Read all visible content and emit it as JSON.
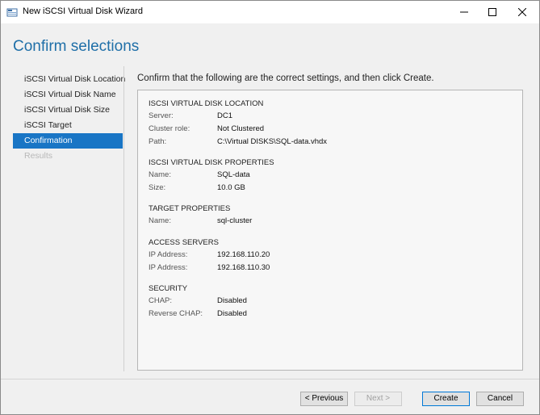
{
  "window": {
    "title": "New iSCSI Virtual Disk Wizard",
    "icon": "wizard-app-icon"
  },
  "page": {
    "heading": "Confirm selections",
    "instruction": "Confirm that the following are the correct settings, and then click Create."
  },
  "nav": {
    "items": [
      {
        "label": "iSCSI Virtual Disk Location",
        "state": "normal"
      },
      {
        "label": "iSCSI Virtual Disk Name",
        "state": "normal"
      },
      {
        "label": "iSCSI Virtual Disk Size",
        "state": "normal"
      },
      {
        "label": "iSCSI Target",
        "state": "normal"
      },
      {
        "label": "Confirmation",
        "state": "active"
      },
      {
        "label": "Results",
        "state": "disabled"
      }
    ]
  },
  "summary": {
    "location": {
      "title": "ISCSI VIRTUAL DISK LOCATION",
      "rows": [
        {
          "label": "Server:",
          "value": "DC1"
        },
        {
          "label": "Cluster role:",
          "value": "Not Clustered"
        },
        {
          "label": "Path:",
          "value": "C:\\Virtual DISKS\\SQL-data.vhdx"
        }
      ]
    },
    "properties": {
      "title": "ISCSI VIRTUAL DISK PROPERTIES",
      "rows": [
        {
          "label": "Name:",
          "value": "SQL-data"
        },
        {
          "label": "Size:",
          "value": "10.0 GB"
        }
      ]
    },
    "target": {
      "title": "TARGET PROPERTIES",
      "rows": [
        {
          "label": "Name:",
          "value": "sql-cluster"
        }
      ]
    },
    "access": {
      "title": "ACCESS SERVERS",
      "rows": [
        {
          "label": "IP Address:",
          "value": "192.168.110.20"
        },
        {
          "label": "IP Address:",
          "value": "192.168.110.30"
        }
      ]
    },
    "security": {
      "title": "SECURITY",
      "rows": [
        {
          "label": "CHAP:",
          "value": "Disabled"
        },
        {
          "label": "Reverse CHAP:",
          "value": "Disabled"
        }
      ]
    }
  },
  "buttons": {
    "previous": "< Previous",
    "next": "Next >",
    "create": "Create",
    "cancel": "Cancel"
  },
  "colors": {
    "heading": "#1f6fa8",
    "active_nav": "#1975c5"
  }
}
